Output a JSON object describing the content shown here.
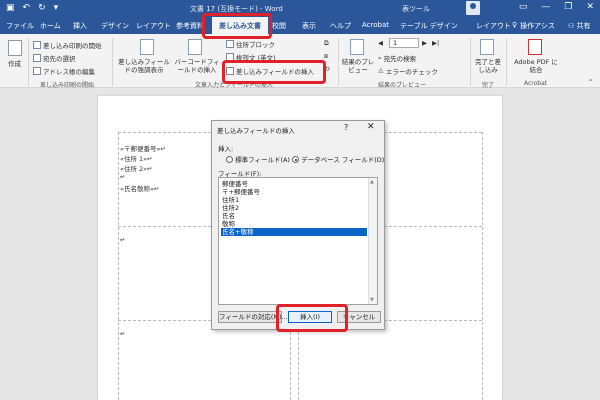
{
  "window": {
    "document_title": "文書 17 (互換モード) - Word",
    "tools_label": "表ツール"
  },
  "tabs": [
    {
      "label": "ファイル"
    },
    {
      "label": "ホーム"
    },
    {
      "label": "挿入"
    },
    {
      "label": "デザイン"
    },
    {
      "label": "レイアウト"
    },
    {
      "label": "参考資料"
    },
    {
      "label": "差し込み文書"
    },
    {
      "label": "校閲"
    },
    {
      "label": "表示"
    },
    {
      "label": "ヘルプ"
    },
    {
      "label": "Acrobat"
    },
    {
      "label": "テーブル デザイン"
    },
    {
      "label": "レイアウト"
    }
  ],
  "tab_help": "操作アシス",
  "tab_share": "共有",
  "ribbon": {
    "create": "作成",
    "start_merge": "差し込み印刷の開始",
    "select_recipients": "宛先の選択",
    "edit_list": "アドレス帳の編集",
    "group_start": "差し込み印刷の開始",
    "highlight_fields": "差し込みフィールドの強調表示",
    "barcode_field": "バーコードフィールドの挿入",
    "address_block": "住所ブロック",
    "greeting": "挨拶文 (英文)",
    "insert_field": "差し込みフィールドの挿入",
    "group_write": "文章入力とフィールドの挿入",
    "preview_results": "結果のプレビュー",
    "record_number": "1",
    "find_recipient": "宛先の検索",
    "check_errors": "エラーのチェック",
    "group_preview": "結果のプレビュー",
    "finish_merge": "完了と差し込み",
    "group_finish": "完了",
    "adobe_pdf": "Adobe PDF に結合",
    "group_acrobat": "Acrobat"
  },
  "document": {
    "lines": [
      "«〒郵便番号»↵",
      "«住所 1»↵",
      "«住所 2»↵",
      "↵",
      "«氏名敬称»↵"
    ],
    "cell_mark": "↵"
  },
  "dialog": {
    "title": "差し込みフィールドの挿入",
    "help": "?",
    "close": "✕",
    "insert_label": "挿入:",
    "radio_standard": "標準フィールド(A)",
    "radio_database": "データベース フィールド(D)",
    "field_label": "フィールド(F):",
    "fields": [
      "郵便番号",
      "〒+郵便番号",
      "住所1",
      "住所2",
      "氏名",
      "敬称",
      "氏名+敬称"
    ],
    "selected_index": 6,
    "match_fields_button": "フィールドの対応(M)...",
    "insert_button": "挿入(I)",
    "cancel_button": "キャンセル"
  },
  "colors": {
    "brand": "#2b579a",
    "highlight": "#e0202a",
    "selection": "#0a64c8"
  }
}
